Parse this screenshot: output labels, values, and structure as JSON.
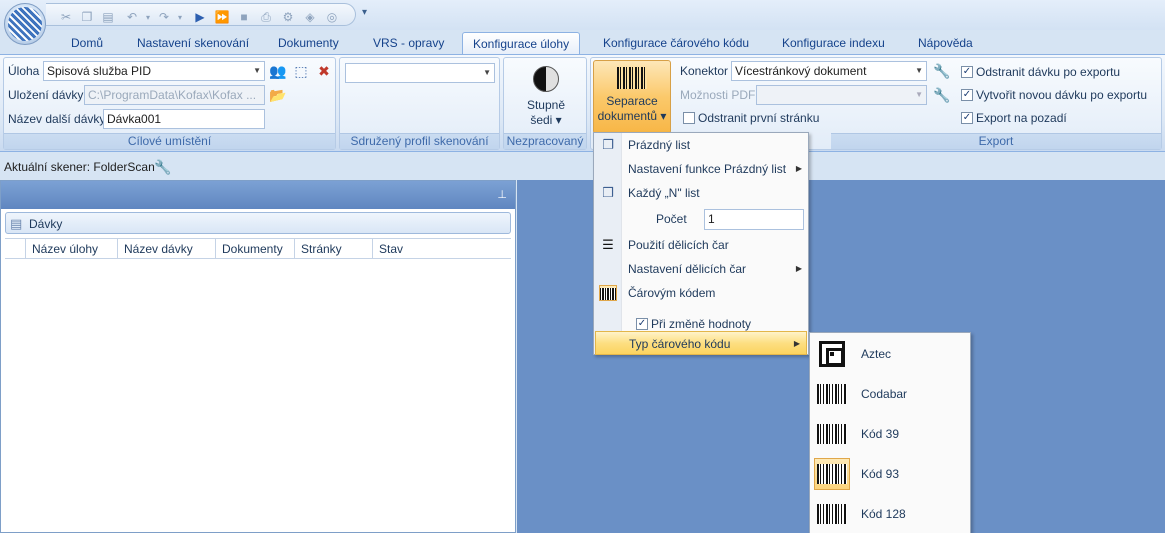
{
  "qat": {
    "customize_glyph": "▾",
    "icons": [
      "cut-icon",
      "copy-icon",
      "paste-icon",
      "undo-icon",
      "redo-icon",
      "play-icon",
      "fast-forward-icon",
      "stop-icon",
      "scan-icon",
      "settings-icon",
      "filter-icon",
      "help-icon"
    ]
  },
  "tabs": [
    {
      "label": "Domů"
    },
    {
      "label": "Nastavení skenování"
    },
    {
      "label": "Dokumenty"
    },
    {
      "label": "VRS - opravy"
    },
    {
      "label": "Konfigurace úlohy",
      "active": true
    },
    {
      "label": "Konfigurace čárového kódu"
    },
    {
      "label": "Konfigurace indexu"
    },
    {
      "label": "Nápověda"
    }
  ],
  "ribbon": {
    "target_group": {
      "label": "Cílové umístění",
      "job_label": "Úloha",
      "job_value": "Spisová služba PID",
      "storage_label": "Uložení dávky",
      "storage_value": "C:\\ProgramData\\Kofax\\Kofax ...",
      "next_batch_label": "Název další dávky",
      "next_batch_value": "Dávka001"
    },
    "shared_profile_group": {
      "label": "Sdružený profil skenování",
      "value": ""
    },
    "raw_group": {
      "label": "Nezpracovaný",
      "button_line1": "Stupně",
      "button_line2": "šedi ▾"
    },
    "separation_button": {
      "line1": "Separace",
      "line2": "dokumentů ▾"
    },
    "export_group": {
      "label": "Export",
      "connector_label": "Konektor",
      "connector_value": "Vícestránkový dokument",
      "pdf_options_label": "Možnosti PDF",
      "pdf_options_value": "",
      "remove_first_page": "Odstranit první stránku",
      "remove_batch_after_export": "Odstranit dávku po exportu",
      "create_new_batch_after_export": "Vytvořit novou dávku po exportu",
      "export_in_background": "Export na pozadí"
    }
  },
  "status": {
    "current_scanner": "Aktuální skener: FolderScan"
  },
  "left_pane": {
    "pin_glyph": "⊥",
    "batches_title": "Dávky",
    "columns": [
      "Název úlohy",
      "Název dávky",
      "Dokumenty",
      "Stránky",
      "Stav"
    ]
  },
  "separation_menu": {
    "blank_page": "Prázdný list",
    "blank_page_settings": "Nastavení funkce Prázdný list",
    "every_n_page": "Každý „N\" list",
    "count_label": "Počet",
    "count_value": "1",
    "use_separator_sheets": "Použití dělicích čar",
    "separator_settings": "Nastavení dělicích čar",
    "by_barcode": "Čárovým kódem",
    "on_value_change": "Při změně hodnoty",
    "barcode_type": "Typ čárového kódu"
  },
  "barcode_submenu": {
    "items": [
      {
        "label": "Aztec"
      },
      {
        "label": "Codabar"
      },
      {
        "label": "Kód 39"
      },
      {
        "label": "Kód 93",
        "selected": true
      },
      {
        "label": "Kód 128"
      }
    ]
  },
  "colors": {
    "ribbon_accent": "#15428b",
    "workspace_bg": "#6a90c6",
    "highlight": "#fcd45f"
  }
}
